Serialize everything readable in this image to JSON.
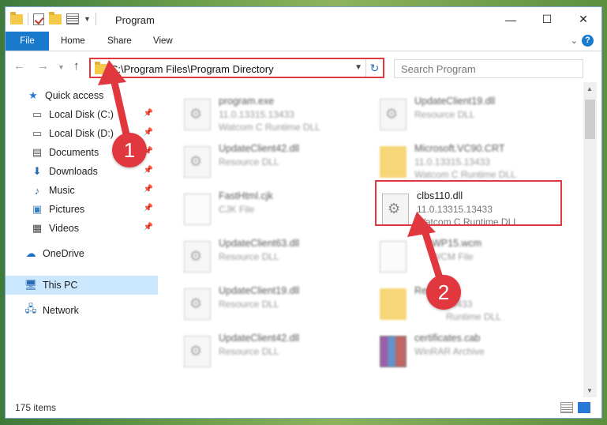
{
  "window": {
    "title": "Program"
  },
  "ribbon": {
    "file": "File",
    "home": "Home",
    "share": "Share",
    "view": "View",
    "help": "?"
  },
  "address": {
    "path": "C:\\Program Files\\Program Directory"
  },
  "search": {
    "placeholder": "Search Program"
  },
  "nav": {
    "quick_access": "Quick access",
    "local_c": "Local Disk (C:)",
    "local_d": "Local Disk (D:)",
    "documents": "Documents",
    "downloads": "Downloads",
    "music": "Music",
    "pictures": "Pictures",
    "videos": "Videos",
    "onedrive": "OneDrive",
    "this_pc": "This PC",
    "network": "Network"
  },
  "files": {
    "f1": {
      "name": "program.exe",
      "line1": "11.0.13315.13433",
      "line2": "Watcom C Runtime DLL"
    },
    "f2": {
      "name": "UpdateClient19.dll",
      "line1": "Resource DLL",
      "line2": ""
    },
    "f3": {
      "name": "UpdateClient42.dll",
      "line1": "Resource DLL",
      "line2": ""
    },
    "f4": {
      "name": "Microsoft.VC90.CRT",
      "line1": "11.0.13315.13433",
      "line2": "Watcom C Runtime DLL"
    },
    "f5": {
      "name": "FastHtml.cjk",
      "line1": "CJK File",
      "line2": ""
    },
    "f6": {
      "name": "clbs110.dll",
      "line1": "11.0.13315.13433",
      "line2": "Watcom C Runtime DLL"
    },
    "f7": {
      "name": "UpdateClient63.dll",
      "line1": "Resource DLL",
      "line2": ""
    },
    "f8": {
      "name": "WP15.wcm",
      "line1": "WCM File",
      "line2": ""
    },
    "f9": {
      "name": "UpdateClient19.dll",
      "line1": "Resource DLL",
      "line2": ""
    },
    "f10": {
      "name": "Res",
      "line1": "13433",
      "line2": "Runtime DLL"
    },
    "f11": {
      "name": "UpdateClient42.dll",
      "line1": "Resource DLL",
      "line2": ""
    },
    "f12": {
      "name": "certificates.cab",
      "line1": "WinRAR Archive",
      "line2": ""
    }
  },
  "status": {
    "count": "175 items"
  },
  "markers": {
    "one": "1",
    "two": "2"
  },
  "colors": {
    "accent": "#1979ca",
    "annotation": "#e0383e"
  }
}
